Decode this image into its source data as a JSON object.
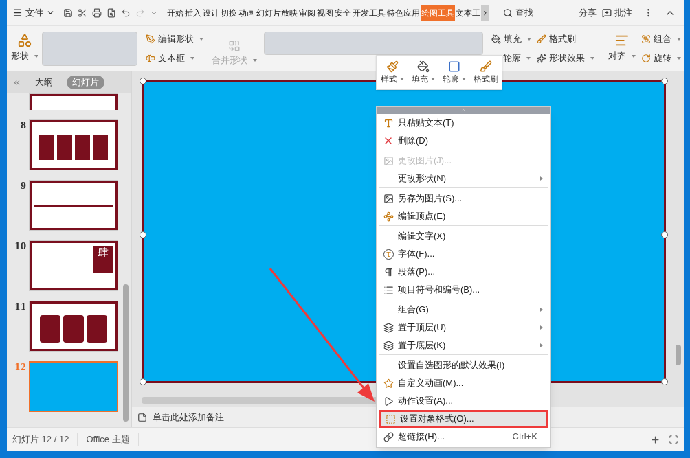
{
  "menu_button": "文件",
  "tabs": [
    {
      "label": "开始",
      "selected": false
    },
    {
      "label": "插入",
      "selected": false
    },
    {
      "label": "设计",
      "selected": false
    },
    {
      "label": "切换",
      "selected": false
    },
    {
      "label": "动画",
      "selected": false
    },
    {
      "label": "幻灯片放映",
      "selected": false
    },
    {
      "label": "审阅",
      "selected": false
    },
    {
      "label": "视图",
      "selected": false
    },
    {
      "label": "安全",
      "selected": false
    },
    {
      "label": "开发工具",
      "selected": false
    },
    {
      "label": "特色应用",
      "selected": false
    },
    {
      "label": "绘图工具",
      "selected": true
    },
    {
      "label": "文本工",
      "selected": false
    }
  ],
  "search": "查找",
  "share": "分享",
  "comment": "批注",
  "ribbon": {
    "shape": "形状",
    "edit_shape": "编辑形状",
    "text_box": "文本框",
    "merge_shape": {
      "label": "合并形状",
      "disabled": true
    },
    "fill": "填充",
    "format_painter": "格式刷",
    "outline": "轮廓",
    "shape_effects": "形状效果",
    "align": "对齐",
    "group": "组合",
    "rotate": "旋转"
  },
  "mini_toolbar": [
    {
      "label": "样式",
      "dropdown": true
    },
    {
      "label": "填充",
      "dropdown": true
    },
    {
      "label": "轮廓",
      "dropdown": true
    },
    {
      "label": "格式刷",
      "dropdown": false
    }
  ],
  "side_panel": {
    "tabs": [
      {
        "label": "大纲",
        "selected": false
      },
      {
        "label": "幻灯片",
        "selected": true
      }
    ],
    "slides": [
      {
        "kind": "partial",
        "selected": false
      },
      {
        "number": "8",
        "kind": "cards",
        "selected": false
      },
      {
        "number": "9",
        "kind": "timeline",
        "selected": false
      },
      {
        "number": "10",
        "kind": "vertical",
        "big_char": "肆",
        "selected": false
      },
      {
        "number": "11",
        "kind": "circles",
        "selected": false
      },
      {
        "number": "12",
        "kind": "blank",
        "selected": true
      }
    ]
  },
  "notes_placeholder": "单击此处添加备注",
  "status_bar": {
    "slide_count": "幻灯片 12 / 12",
    "theme": "Office 主题"
  },
  "context_menu": {
    "items": [
      {
        "label": "只粘贴文本(T)",
        "disabled": false,
        "submenu": false,
        "selected": false,
        "separator_before": false
      },
      {
        "label": "删除(D)",
        "disabled": false,
        "submenu": false,
        "selected": false,
        "separator_before": false
      },
      {
        "label": "更改图片(J)...",
        "disabled": true,
        "submenu": false,
        "selected": false,
        "separator_before": true
      },
      {
        "label": "更改形状(N)",
        "disabled": false,
        "submenu": true,
        "selected": false,
        "separator_before": false
      },
      {
        "label": "另存为图片(S)...",
        "disabled": false,
        "submenu": false,
        "selected": false,
        "separator_before": true
      },
      {
        "label": "编辑顶点(E)",
        "disabled": false,
        "submenu": false,
        "selected": false,
        "separator_before": false
      },
      {
        "label": "编辑文字(X)",
        "disabled": false,
        "submenu": false,
        "selected": false,
        "separator_before": true
      },
      {
        "label": "字体(F)...",
        "disabled": false,
        "submenu": false,
        "selected": false,
        "separator_before": false
      },
      {
        "label": "段落(P)...",
        "disabled": false,
        "submenu": false,
        "selected": false,
        "separator_before": false
      },
      {
        "label": "项目符号和编号(B)...",
        "disabled": false,
        "submenu": false,
        "selected": false,
        "separator_before": false
      },
      {
        "label": "组合(G)",
        "disabled": false,
        "submenu": true,
        "selected": false,
        "separator_before": true
      },
      {
        "label": "置于顶层(U)",
        "disabled": false,
        "submenu": true,
        "selected": false,
        "separator_before": false
      },
      {
        "label": "置于底层(K)",
        "disabled": false,
        "submenu": true,
        "selected": false,
        "separator_before": false
      },
      {
        "label": "设置自选图形的默认效果(I)",
        "disabled": false,
        "submenu": false,
        "selected": false,
        "separator_before": true
      },
      {
        "label": "自定义动画(M)...",
        "disabled": false,
        "submenu": false,
        "selected": false,
        "separator_before": false
      },
      {
        "label": "动作设置(A)...",
        "disabled": false,
        "submenu": false,
        "selected": false,
        "separator_before": false
      },
      {
        "label": "设置对象格式(O)...",
        "disabled": false,
        "submenu": false,
        "selected": true,
        "separator_before": false
      },
      {
        "label": "超链接(H)...",
        "shortcut": "Ctrl+K",
        "disabled": false,
        "submenu": false,
        "selected": false,
        "separator_before": false
      }
    ]
  }
}
